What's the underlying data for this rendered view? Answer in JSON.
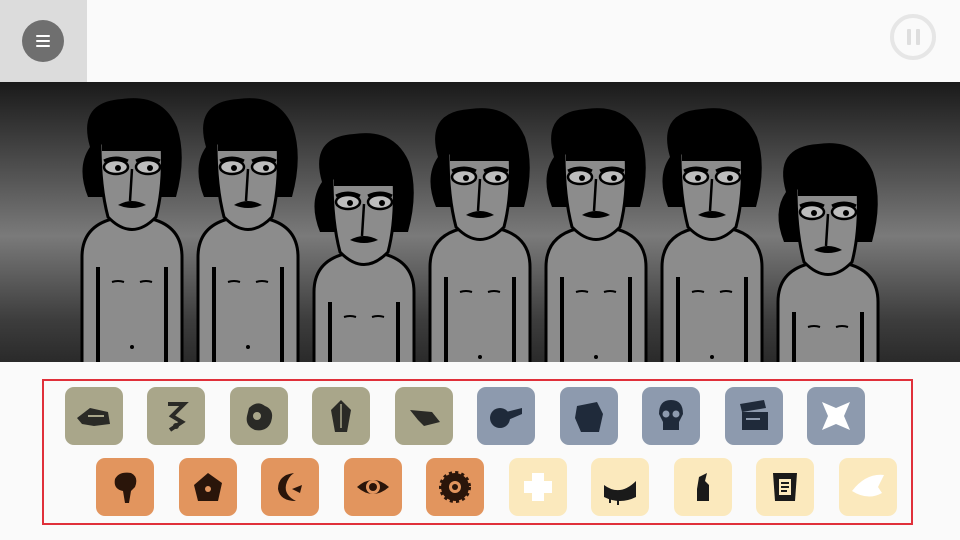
{
  "menu": {
    "icon": "hamburger-menu-icon"
  },
  "pause": {
    "icon": "pause-icon"
  },
  "stage": {
    "characters": [
      {
        "id": 1,
        "state": "idle"
      },
      {
        "id": 2,
        "state": "idle"
      },
      {
        "id": 3,
        "state": "idle"
      },
      {
        "id": 4,
        "state": "idle"
      },
      {
        "id": 5,
        "state": "idle"
      },
      {
        "id": 6,
        "state": "idle"
      },
      {
        "id": 7,
        "state": "idle"
      }
    ]
  },
  "palette": {
    "row1": [
      {
        "icon": "hand-icon",
        "color": "#a9a68a"
      },
      {
        "icon": "zigzag-icon",
        "color": "#a9a68a"
      },
      {
        "icon": "blob-icon",
        "color": "#a9a68a"
      },
      {
        "icon": "mask-icon",
        "color": "#a9a68a"
      },
      {
        "icon": "hat-icon",
        "color": "#a9a68a"
      },
      {
        "icon": "pipe-icon",
        "color": "#8d9aae"
      },
      {
        "icon": "helmet-icon",
        "color": "#8d9aae"
      },
      {
        "icon": "skull-icon",
        "color": "#8d9aae"
      },
      {
        "icon": "clapperboard-icon",
        "color": "#8d9aae"
      },
      {
        "icon": "star-shape-icon",
        "color": "#8d9aae"
      }
    ],
    "row2": [
      {
        "icon": "drip-icon",
        "color": "#e2955e"
      },
      {
        "icon": "house-eye-icon",
        "color": "#e2955e"
      },
      {
        "icon": "crescent-icon",
        "color": "#e2955e"
      },
      {
        "icon": "eye-icon",
        "color": "#e2955e"
      },
      {
        "icon": "gear-icon",
        "color": "#e2955e"
      },
      {
        "icon": "cross-icon",
        "color": "#fbe9bd"
      },
      {
        "icon": "slime-icon",
        "color": "#fbe9bd"
      },
      {
        "icon": "figure-icon",
        "color": "#fbe9bd"
      },
      {
        "icon": "scroll-icon",
        "color": "#fbe9bd"
      },
      {
        "icon": "wing-icon",
        "color": "#fbe9bd"
      }
    ]
  }
}
